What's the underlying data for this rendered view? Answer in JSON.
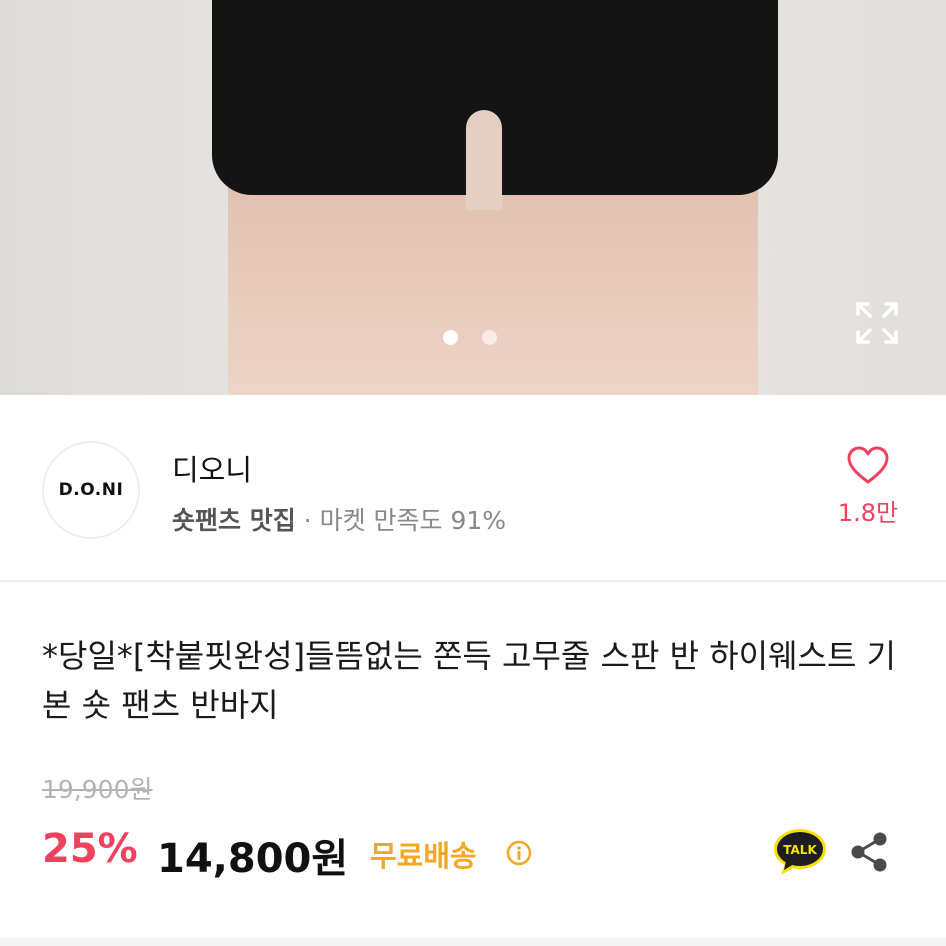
{
  "gallery": {
    "slides": 2,
    "active_slide": 1
  },
  "seller": {
    "logo_text": "D.O.NI",
    "name": "디오니",
    "category": "숏팬츠 맛집",
    "separator": " · ",
    "satisfaction": "마켓 만족도 91%",
    "likes": "1.8만"
  },
  "product": {
    "title": "*당일*[착붙핏완성]들뜸없는 쫀득 고무줄 스판 반 하이웨스트 기본 숏 팬츠 반바지",
    "original_price": "19,900원",
    "discount": "25%",
    "price": "14,800원",
    "shipping": "무료배송"
  },
  "icons": {
    "expand": "expand-icon",
    "heart": "heart-icon",
    "info": "info-icon",
    "talk": "kakao-talk-icon",
    "share": "share-icon"
  },
  "colors": {
    "accent_pink": "#f0425f",
    "shipping_orange": "#f4a724",
    "talk_yellow": "#f9e000"
  }
}
